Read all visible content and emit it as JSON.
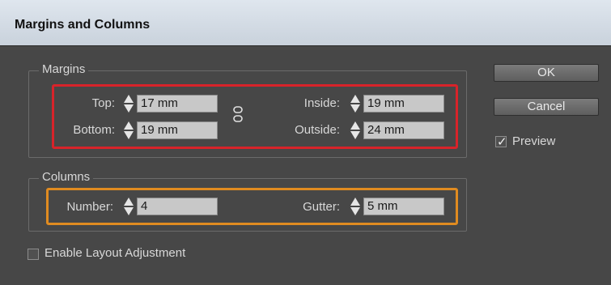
{
  "window": {
    "title": "Margins and Columns"
  },
  "margins": {
    "group_label": "Margins",
    "top": {
      "label": "Top:",
      "value": "17 mm"
    },
    "bottom": {
      "label": "Bottom:",
      "value": "19 mm"
    },
    "inside": {
      "label": "Inside:",
      "value": "19 mm"
    },
    "outside": {
      "label": "Outside:",
      "value": "24 mm"
    }
  },
  "columns": {
    "group_label": "Columns",
    "number": {
      "label": "Number:",
      "value": "4"
    },
    "gutter": {
      "label": "Gutter:",
      "value": "5 mm"
    }
  },
  "buttons": {
    "ok": "OK",
    "cancel": "Cancel"
  },
  "preview": {
    "label": "Preview",
    "checked": true
  },
  "enable_layout_adjustment": {
    "label": "Enable Layout Adjustment",
    "checked": false
  },
  "colors": {
    "highlight_margins": "#d8232a",
    "highlight_columns": "#e08b20"
  }
}
